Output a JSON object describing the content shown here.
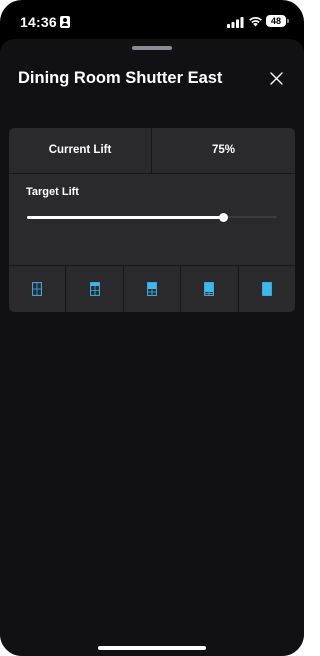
{
  "status_bar": {
    "time": "14:36",
    "battery": "48"
  },
  "sheet": {
    "title": "Dining Room Shutter East"
  },
  "current_lift": {
    "label": "Current Lift",
    "value": "75%"
  },
  "target_lift": {
    "label": "Target Lift",
    "fraction": 0.75
  },
  "presets": [
    {
      "name": "shutter-preset-0-icon",
      "fill": 0.0
    },
    {
      "name": "shutter-preset-25-icon",
      "fill": 0.25
    },
    {
      "name": "shutter-preset-50-icon",
      "fill": 0.5
    },
    {
      "name": "shutter-preset-75-icon",
      "fill": 0.75
    },
    {
      "name": "shutter-preset-100-icon",
      "fill": 1.0
    }
  ],
  "colors": {
    "accent": "#3fb6ea",
    "background": "#111113",
    "card": "#2a2a2d"
  }
}
